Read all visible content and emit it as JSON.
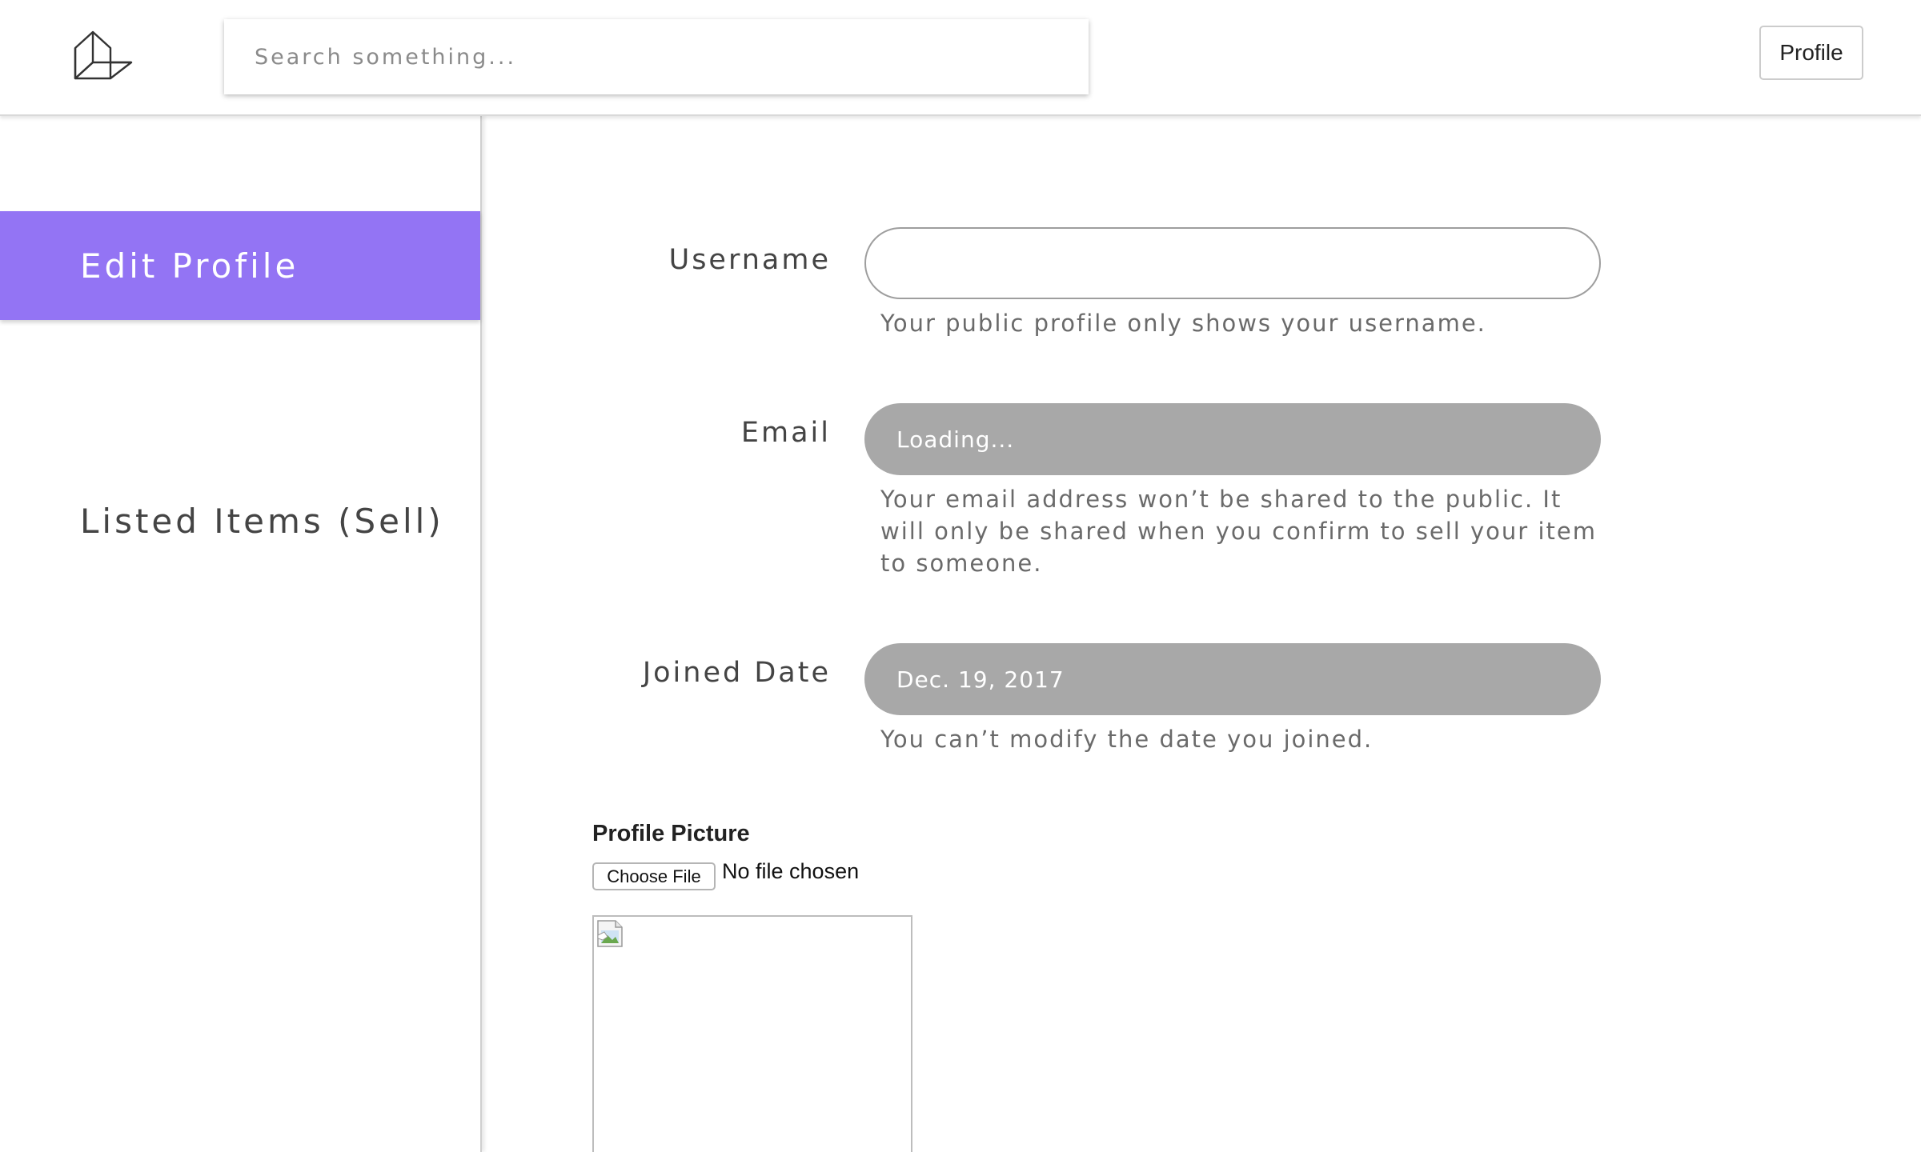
{
  "header": {
    "logo_icon": "cube-outline-icon",
    "search": {
      "placeholder": "Search something...",
      "value": ""
    },
    "profile_button_label": "Profile"
  },
  "sidebar": {
    "accent_color": "#9374f4",
    "items": [
      {
        "label": "Edit Profile",
        "active": true
      },
      {
        "label": "Listed Items (Sell)",
        "active": false
      }
    ]
  },
  "form": {
    "username": {
      "label": "Username",
      "value": "",
      "helper": "Your public profile only shows your username."
    },
    "email": {
      "label": "Email",
      "value": "Loading...",
      "helper": "Your email address won’t be shared to the public. It will only be shared when you confirm to sell your item to someone."
    },
    "joined_date": {
      "label": "Joined Date",
      "value": "Dec. 19, 2017",
      "helper": "You can’t modify the date you joined."
    },
    "profile_picture": {
      "label": "Profile Picture",
      "choose_file_label": "Choose File",
      "file_status": "No file chosen",
      "image_icon": "broken-image-icon"
    }
  },
  "colors": {
    "readonly_field_bg": "#a8a8a8",
    "helper_text": "#6a6a6a"
  }
}
